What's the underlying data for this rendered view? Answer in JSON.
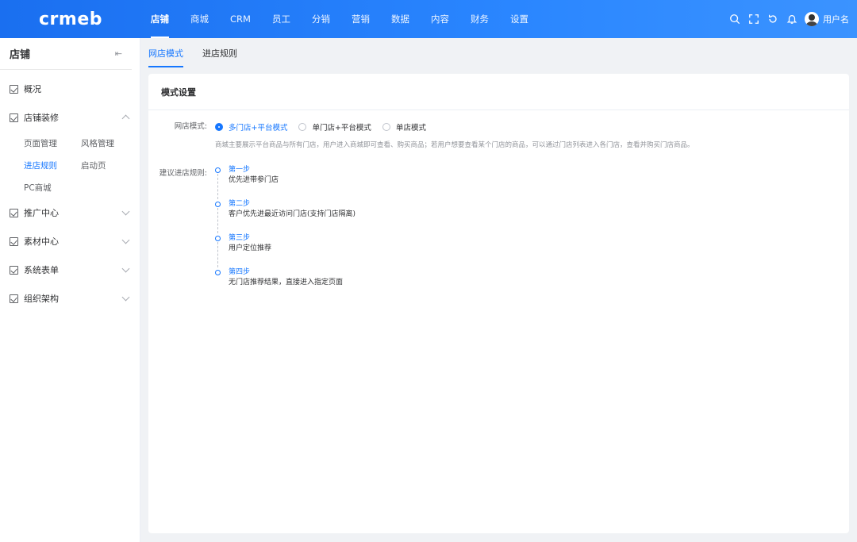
{
  "brand": {
    "logo_text": "crmeb"
  },
  "topnav": {
    "items": [
      {
        "label": "店铺",
        "active": true
      },
      {
        "label": "商城"
      },
      {
        "label": "CRM"
      },
      {
        "label": "员工"
      },
      {
        "label": "分销"
      },
      {
        "label": "营销"
      },
      {
        "label": "数据"
      },
      {
        "label": "内容"
      },
      {
        "label": "财务"
      },
      {
        "label": "设置"
      }
    ],
    "right_icons": [
      "search-icon",
      "fullscreen-icon",
      "refresh-icon",
      "bell-icon"
    ],
    "user_name": "用户名"
  },
  "sidebar": {
    "title": "店铺",
    "collapse_glyph": "⇤",
    "items": [
      {
        "label": "概况"
      },
      {
        "label": "店铺装修",
        "expanded": true,
        "children": [
          {
            "label": "页面管理"
          },
          {
            "label": "风格管理"
          },
          {
            "label": "进店规则",
            "active": true
          },
          {
            "label": "启动页"
          },
          {
            "label": "PC商城"
          }
        ]
      },
      {
        "label": "推广中心"
      },
      {
        "label": "素材中心"
      },
      {
        "label": "系统表单"
      },
      {
        "label": "组织架构"
      }
    ]
  },
  "tabs": [
    {
      "label": "网店模式",
      "active": true
    },
    {
      "label": "进店规则"
    }
  ],
  "card": {
    "title": "模式设置",
    "mode_label": "网店模式:",
    "mode_options": [
      {
        "label": "多门店+平台模式",
        "checked": true
      },
      {
        "label": "单门店+平台模式"
      },
      {
        "label": "单店模式"
      }
    ],
    "hint": "商城主要展示平台商品与所有门店，用户进入商城即可查看、购买商品；若用户想要查看某个门店的商品，可以通过门店列表进入各门店，查看并购买门店商品。",
    "rules_label": "建议进店规则:",
    "steps": [
      {
        "title": "第一步",
        "desc": "优先进带参门店"
      },
      {
        "title": "第二步",
        "desc": "客户优先进最近访问门店(支持门店隔离)"
      },
      {
        "title": "第三步",
        "desc": "用户定位推荐"
      },
      {
        "title": "第四步",
        "desc": "无门店推荐结果，直接进入指定页面"
      }
    ]
  },
  "colors": {
    "accent": "#1677ff",
    "topbar": "#2a86ff"
  }
}
